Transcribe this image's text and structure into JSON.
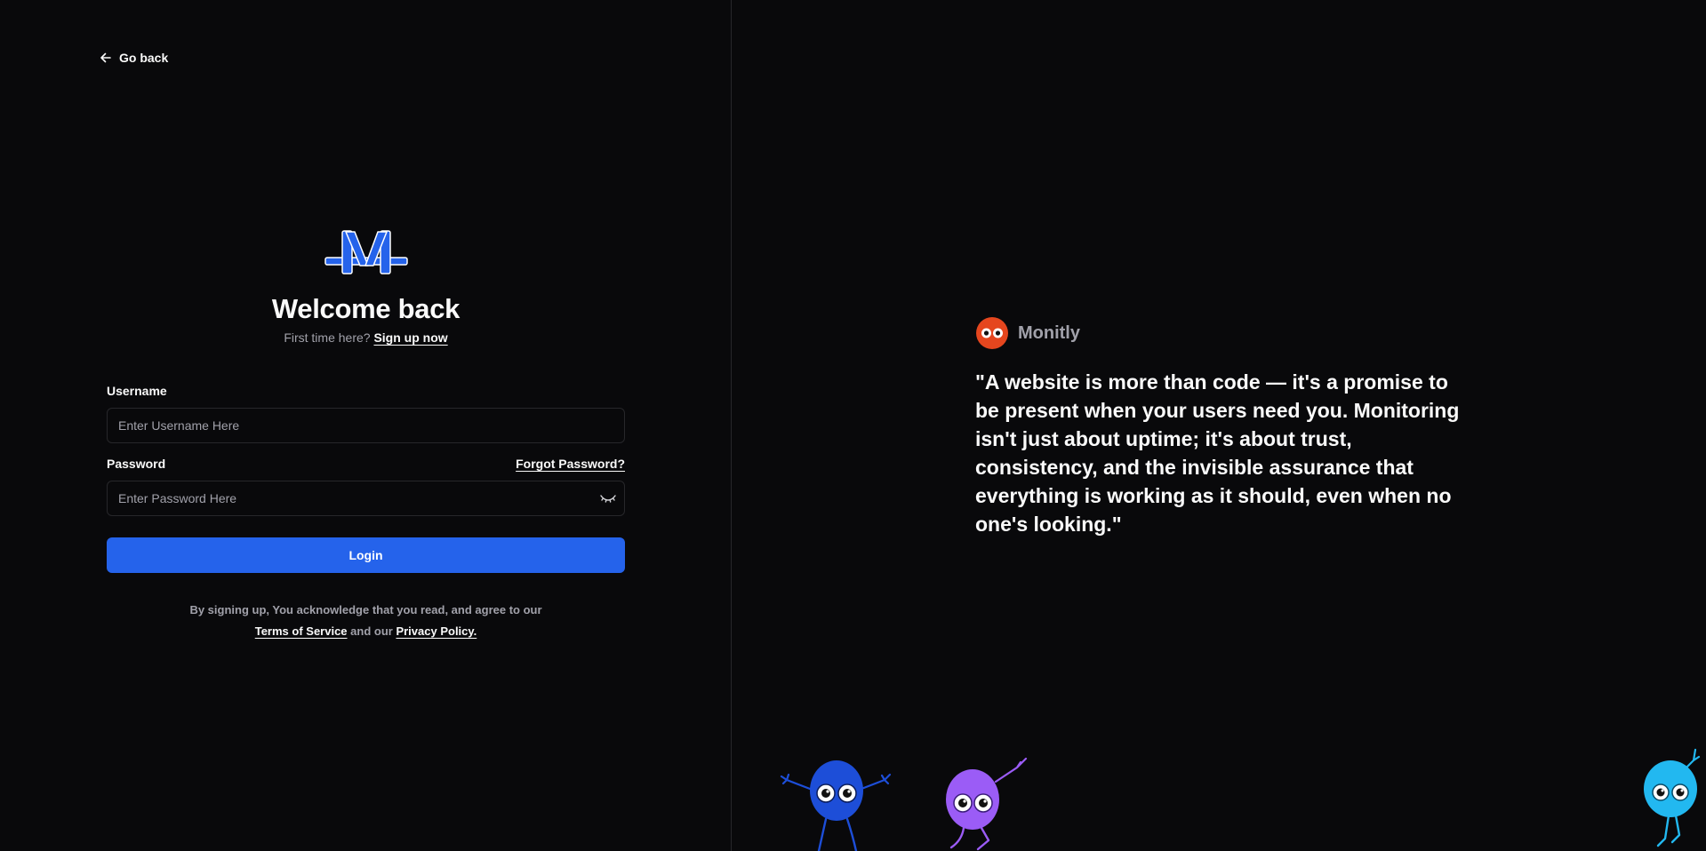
{
  "nav": {
    "go_back_label": "Go back",
    "go_back_icon": "arrow-left-icon"
  },
  "header": {
    "logo_icon": "monitly-m-logo",
    "title": "Welcome back",
    "subtitle_prefix": "First time here?",
    "signup_link": "Sign up now"
  },
  "form": {
    "username_label": "Username",
    "username_placeholder": "Enter Username Here",
    "username_value": "",
    "password_label": "Password",
    "forgot_password_link": "Forgot Password?",
    "password_placeholder": "Enter Password Here",
    "password_value": "",
    "password_toggle_icon": "eye-closed-icon",
    "login_button": "Login"
  },
  "legal": {
    "line1": "By signing up, You acknowledge that you read, and agree to our",
    "terms_link": "Terms of Service",
    "connector": "and our",
    "privacy_link": "Privacy Policy."
  },
  "showcase": {
    "brand_icon": "monitly-eyes-icon",
    "brand_name": "Monitly",
    "quote": "\"A website is more than code — it's a promise to be present when your users need you. Monitoring isn't just about uptime; it's about trust, consistency, and the invisible assurance that everything is working as it should, even when no one's looking.\""
  },
  "colors": {
    "background": "#09090b",
    "border": "#27272a",
    "muted_text": "#a1a1aa",
    "primary": "#2563eb",
    "brand_orange": "#e5461e",
    "creature_blue": "#1d4ed8",
    "creature_purple": "#9b5cf6",
    "creature_cyan": "#22b8f0"
  }
}
